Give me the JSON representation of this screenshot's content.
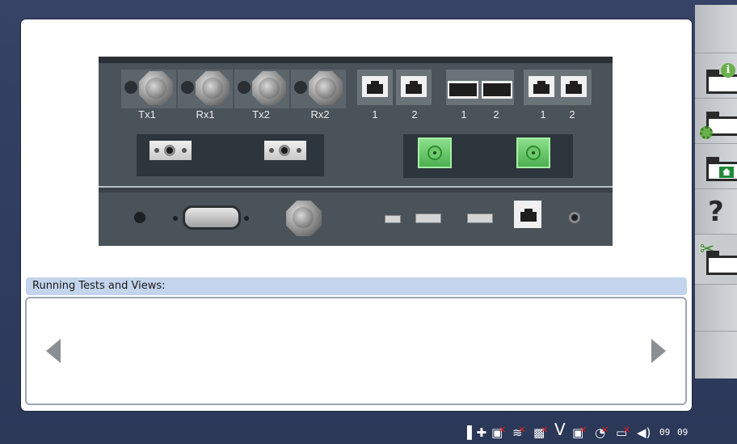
{
  "front_panel": {
    "bnc_labels": [
      "Tx1",
      "Rx1",
      "Tx2",
      "Rx2"
    ],
    "rj_group1_labels": [
      "1",
      "2"
    ],
    "sfp_labels": [
      "1",
      "2"
    ],
    "rj_group2_labels": [
      "1",
      "2"
    ]
  },
  "running_tests": {
    "title": "Running Tests and Views:"
  },
  "sidebar": {
    "help_label": "?"
  },
  "taskbar": {
    "clock_hour": "09",
    "clock_minute": "09",
    "v_label": "V"
  },
  "colors": {
    "desktop_bg": "#364266",
    "panel_bg": "#4a5359",
    "header_bar": "#c3d4ec",
    "accent_green": "#4caf50"
  }
}
